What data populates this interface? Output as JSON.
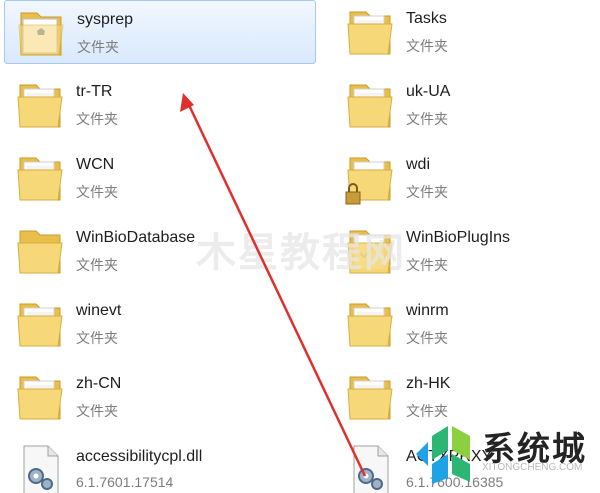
{
  "items": [
    {
      "id": "sysprep",
      "name": "sysprep",
      "type": "文件夹",
      "icon": "folder-doc-icon",
      "selected": true
    },
    {
      "id": "tasks",
      "name": "Tasks",
      "type": "文件夹",
      "icon": "folder-icon"
    },
    {
      "id": "tr-tr",
      "name": "tr-TR",
      "type": "文件夹",
      "icon": "folder-icon"
    },
    {
      "id": "uk-ua",
      "name": "uk-UA",
      "type": "文件夹",
      "icon": "folder-icon"
    },
    {
      "id": "wcn",
      "name": "WCN",
      "type": "文件夹",
      "icon": "folder-icon"
    },
    {
      "id": "wdi",
      "name": "wdi",
      "type": "文件夹",
      "icon": "folder-lock-icon"
    },
    {
      "id": "winbiodatabase",
      "name": "WinBioDatabase",
      "type": "文件夹",
      "icon": "folder-icon"
    },
    {
      "id": "winbioplugins",
      "name": "WinBioPlugIns",
      "type": "文件夹",
      "icon": "folder-icon"
    },
    {
      "id": "winevt",
      "name": "winevt",
      "type": "文件夹",
      "icon": "folder-icon"
    },
    {
      "id": "winrm",
      "name": "winrm",
      "type": "文件夹",
      "icon": "folder-icon"
    },
    {
      "id": "zh-cn",
      "name": "zh-CN",
      "type": "文件夹",
      "icon": "folder-icon"
    },
    {
      "id": "zh-hk",
      "name": "zh-HK",
      "type": "文件夹",
      "icon": "folder-icon"
    },
    {
      "id": "accessibilitycpl",
      "name": "accessibilitycpl.dll",
      "type": "6.1.7601.17514",
      "icon": "dll-file-icon"
    },
    {
      "id": "actxprxy",
      "name": "ACTXPRXY",
      "type": "6.1.7600.16385",
      "icon": "dll-file-icon"
    }
  ],
  "watermark": {
    "text": "木星教程网"
  },
  "logo": {
    "text": "系统城",
    "subtext": "XITONGCHENG.COM"
  },
  "colors": {
    "folder_front": "#f7d879",
    "folder_back": "#e9bf4c",
    "selection_border": "#a7c9ef",
    "arrow": "#e0302e"
  }
}
